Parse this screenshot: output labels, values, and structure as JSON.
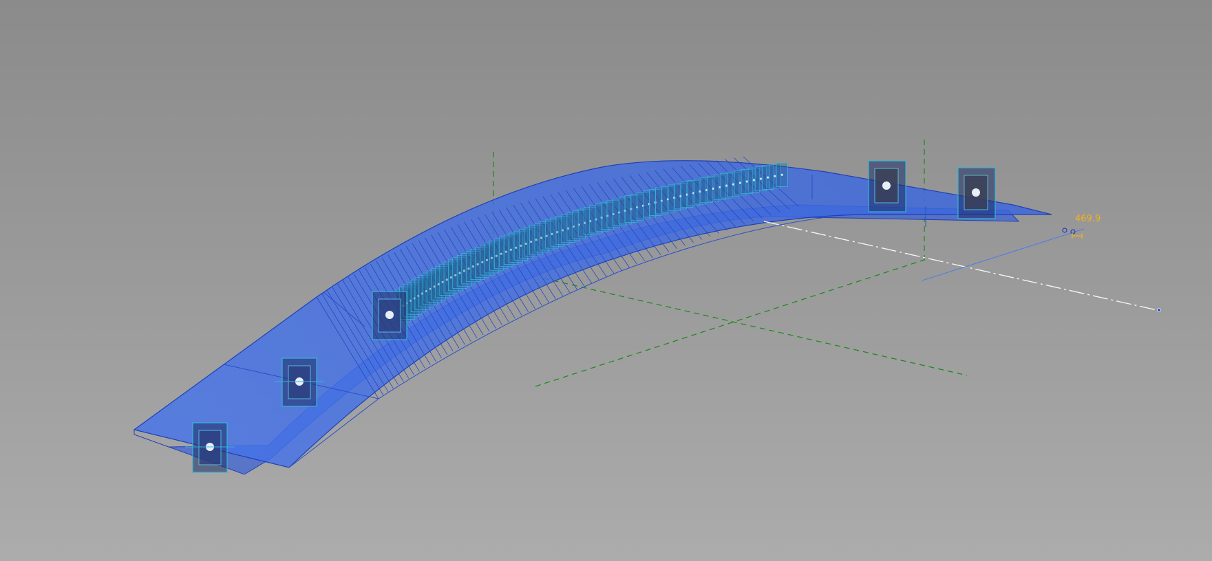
{
  "viewport": {
    "background_top": "#8b8b8b",
    "background_bottom": "#acacac"
  },
  "model": {
    "element_fill": "#3d6ee6",
    "element_stroke": "#1f3fb5",
    "section_plane_color": "#36b6d8",
    "reference_line_color": "#1f8a1f",
    "centerline_color": "#f5f5f5"
  },
  "dimension": {
    "value": "469.9",
    "color": "#f2b21c"
  }
}
